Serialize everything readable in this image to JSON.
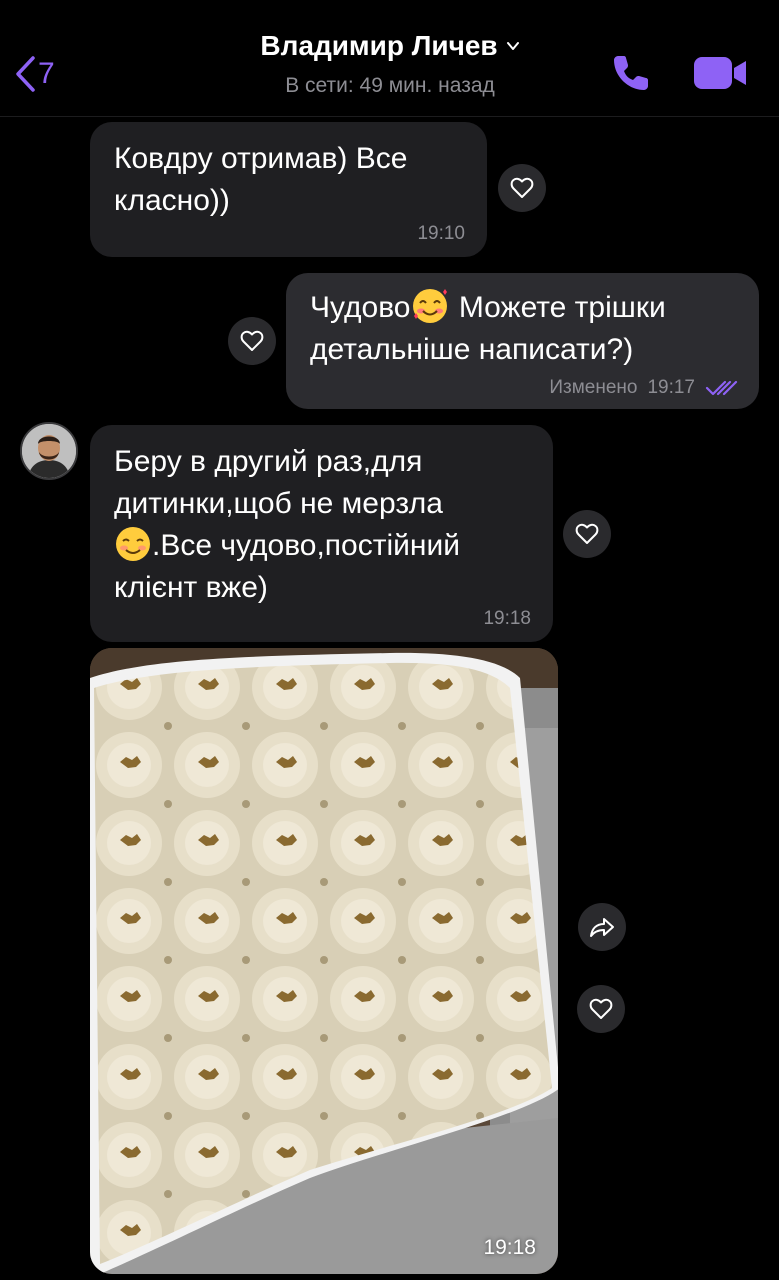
{
  "header": {
    "back_count": "7",
    "contact_name": "Владимир Личев",
    "status": "В сети: 49 мин. назад"
  },
  "messages": [
    {
      "direction": "in",
      "text": "Ковдру отримав) Все класно))",
      "time": "19:10"
    },
    {
      "direction": "out",
      "text_before_emoji": "Чудово",
      "emoji": "smiling-face-with-hearts",
      "text_after_emoji": " Можете трішки детальніше написати?)",
      "edited_label": "Изменено",
      "time": "19:17",
      "read": true
    },
    {
      "direction": "in",
      "text_line1": "Беру в другий раз,для",
      "text_line2": "дитинки,щоб не мерзла",
      "emoji": "smiling-face",
      "text_line3": ".Все чудово,постійний",
      "text_line4": "клієнт вже)",
      "time": "19:18"
    },
    {
      "direction": "in",
      "type": "photo",
      "subject": "blanket on bed",
      "time": "19:18"
    }
  ],
  "colors": {
    "accent": "#8e62f5",
    "bubble_in": "#1f1f22",
    "bubble_out": "#2c2c30",
    "meta_text": "#8d8d93"
  }
}
